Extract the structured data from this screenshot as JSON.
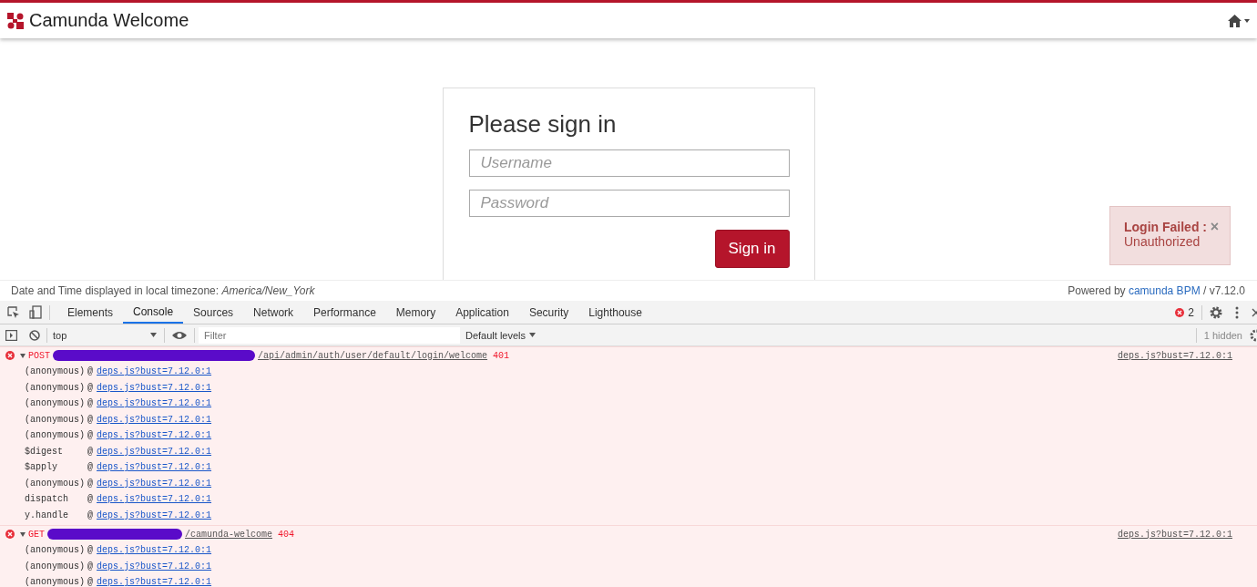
{
  "header": {
    "title": "Camunda Welcome"
  },
  "login": {
    "title": "Please sign in",
    "fields": [
      {
        "placeholder": "Username"
      },
      {
        "placeholder": "Password"
      }
    ],
    "button": "Sign in"
  },
  "alert": {
    "title": "Login Failed :",
    "message": "Unauthorized",
    "close": "×"
  },
  "footer": {
    "timezone": "Date and Time displayed in local timezone: *America/New_York*",
    "powered_by": "Powered by",
    "link": "camunda BPM",
    "version": "/ v7.12.0"
  },
  "devtools": {
    "tabs": [
      {
        "label": "Elements",
        "selected": false
      },
      {
        "label": "Console",
        "selected": true
      },
      {
        "label": "Sources",
        "selected": false
      },
      {
        "label": "Network",
        "selected": false
      },
      {
        "label": "Performance",
        "selected": false
      },
      {
        "label": "Memory",
        "selected": false
      },
      {
        "label": "Application",
        "selected": false
      },
      {
        "label": "Security",
        "selected": false
      },
      {
        "label": "Lighthouse",
        "selected": false
      }
    ],
    "error_count": "2",
    "context": "top",
    "filter_placeholder": "Filter",
    "levels": "Default levels",
    "hidden": "1 hidden"
  },
  "console": [
    {
      "method": "POST",
      "url": "/api/admin/auth/user/default/login/welcome",
      "status": "401",
      "source": "deps.js?bust=7.12.0:1",
      "expanded": true,
      "frames": [
        {
          "fn": "(anonymous)",
          "at": "@",
          "link": "deps.js?bust=7.12.0:1"
        },
        {
          "fn": "(anonymous)",
          "at": "@",
          "link": "deps.js?bust=7.12.0:1"
        },
        {
          "fn": "(anonymous)",
          "at": "@",
          "link": "deps.js?bust=7.12.0:1"
        },
        {
          "fn": "(anonymous)",
          "at": "@",
          "link": "deps.js?bust=7.12.0:1"
        },
        {
          "fn": "(anonymous)",
          "at": "@",
          "link": "deps.js?bust=7.12.0:1"
        },
        {
          "fn": "$digest",
          "at": "@",
          "link": "deps.js?bust=7.12.0:1"
        },
        {
          "fn": "$apply",
          "at": "@",
          "link": "deps.js?bust=7.12.0:1"
        },
        {
          "fn": "(anonymous)",
          "at": "@",
          "link": "deps.js?bust=7.12.0:1"
        },
        {
          "fn": "dispatch",
          "at": "@",
          "link": "deps.js?bust=7.12.0:1"
        },
        {
          "fn": "y.handle",
          "at": "@",
          "link": "deps.js?bust=7.12.0:1"
        }
      ]
    },
    {
      "method": "GET",
      "url": "/camunda-welcome",
      "status": "404",
      "source": "deps.js?bust=7.12.0:1",
      "expanded": true,
      "frames": [
        {
          "fn": "(anonymous)",
          "at": "@",
          "link": "deps.js?bust=7.12.0:1"
        },
        {
          "fn": "(anonymous)",
          "at": "@",
          "link": "deps.js?bust=7.12.0:1"
        },
        {
          "fn": "(anonymous)",
          "at": "@",
          "link": "deps.js?bust=7.12.0:1"
        }
      ]
    }
  ]
}
